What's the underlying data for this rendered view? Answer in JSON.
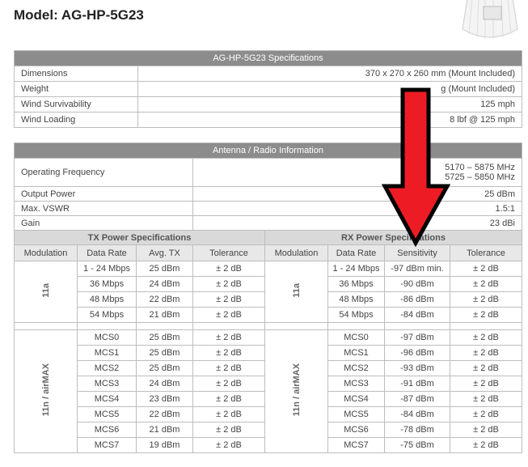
{
  "model_title": "Model: AG-HP-5G23",
  "spec_table": {
    "title": "AG-HP-5G23 Specifications",
    "rows": [
      {
        "label": "Dimensions",
        "value": "370 x 270 x 260 mm (Mount Included)"
      },
      {
        "label": "Weight",
        "value": "g (Mount Included)"
      },
      {
        "label": "Wind Survivability",
        "value": "125 mph"
      },
      {
        "label": "Wind Loading",
        "value": "8 lbf @ 125 mph"
      }
    ]
  },
  "radio_table": {
    "title": "Antenna / Radio Information",
    "rows": [
      {
        "label": "Operating Frequency",
        "value": "5170 – 5875 MHz",
        "value2": "5725 – 5850 MHz"
      },
      {
        "label": "Output Power",
        "value": "25 dBm"
      },
      {
        "label": "Max. VSWR",
        "value": "1.5:1"
      },
      {
        "label": "Gain",
        "value": "23 dBi"
      }
    ]
  },
  "power": {
    "tx_title": "TX Power Specifications",
    "rx_title": "RX Power Specifications",
    "tx_cols": [
      "Modulation",
      "Data Rate",
      "Avg. TX",
      "Tolerance"
    ],
    "rx_cols": [
      "Modulation",
      "Data Rate",
      "Sensitivity",
      "Tolerance"
    ],
    "groups": [
      {
        "modulation": "11a",
        "rows": [
          [
            "1 - 24 Mbps",
            "25 dBm",
            "± 2 dB",
            "1 - 24 Mbps",
            "-97 dBm min.",
            "± 2 dB"
          ],
          [
            "36 Mbps",
            "24 dBm",
            "± 2 dB",
            "36 Mbps",
            "-90 dBm",
            "± 2 dB"
          ],
          [
            "48 Mbps",
            "22 dBm",
            "± 2 dB",
            "48 Mbps",
            "-86 dBm",
            "± 2 dB"
          ],
          [
            "54 Mbps",
            "21 dBm",
            "± 2 dB",
            "54 Mbps",
            "-84 dBm",
            "± 2 dB"
          ]
        ]
      },
      {
        "modulation": "11n / airMAX",
        "rows": [
          [
            "MCS0",
            "25 dBm",
            "± 2 dB",
            "MCS0",
            "-97 dBm",
            "± 2 dB"
          ],
          [
            "MCS1",
            "25 dBm",
            "± 2 dB",
            "MCS1",
            "-96 dBm",
            "± 2 dB"
          ],
          [
            "MCS2",
            "25 dBm",
            "± 2 dB",
            "MCS2",
            "-93 dBm",
            "± 2 dB"
          ],
          [
            "MCS3",
            "24 dBm",
            "± 2 dB",
            "MCS3",
            "-91 dBm",
            "± 2 dB"
          ],
          [
            "MCS4",
            "23 dBm",
            "± 2 dB",
            "MCS4",
            "-87 dBm",
            "± 2 dB"
          ],
          [
            "MCS5",
            "22 dBm",
            "± 2 dB",
            "MCS5",
            "-84 dBm",
            "± 2 dB"
          ],
          [
            "MCS6",
            "21 dBm",
            "± 2 dB",
            "MCS6",
            "-78 dBm",
            "± 2 dB"
          ],
          [
            "MCS7",
            "19 dBm",
            "± 2 dB",
            "MCS7",
            "-75 dBm",
            "± 2 dB"
          ]
        ]
      }
    ]
  },
  "colors": {
    "arrow": "#ed1c24",
    "header": "#8c8c8c"
  }
}
